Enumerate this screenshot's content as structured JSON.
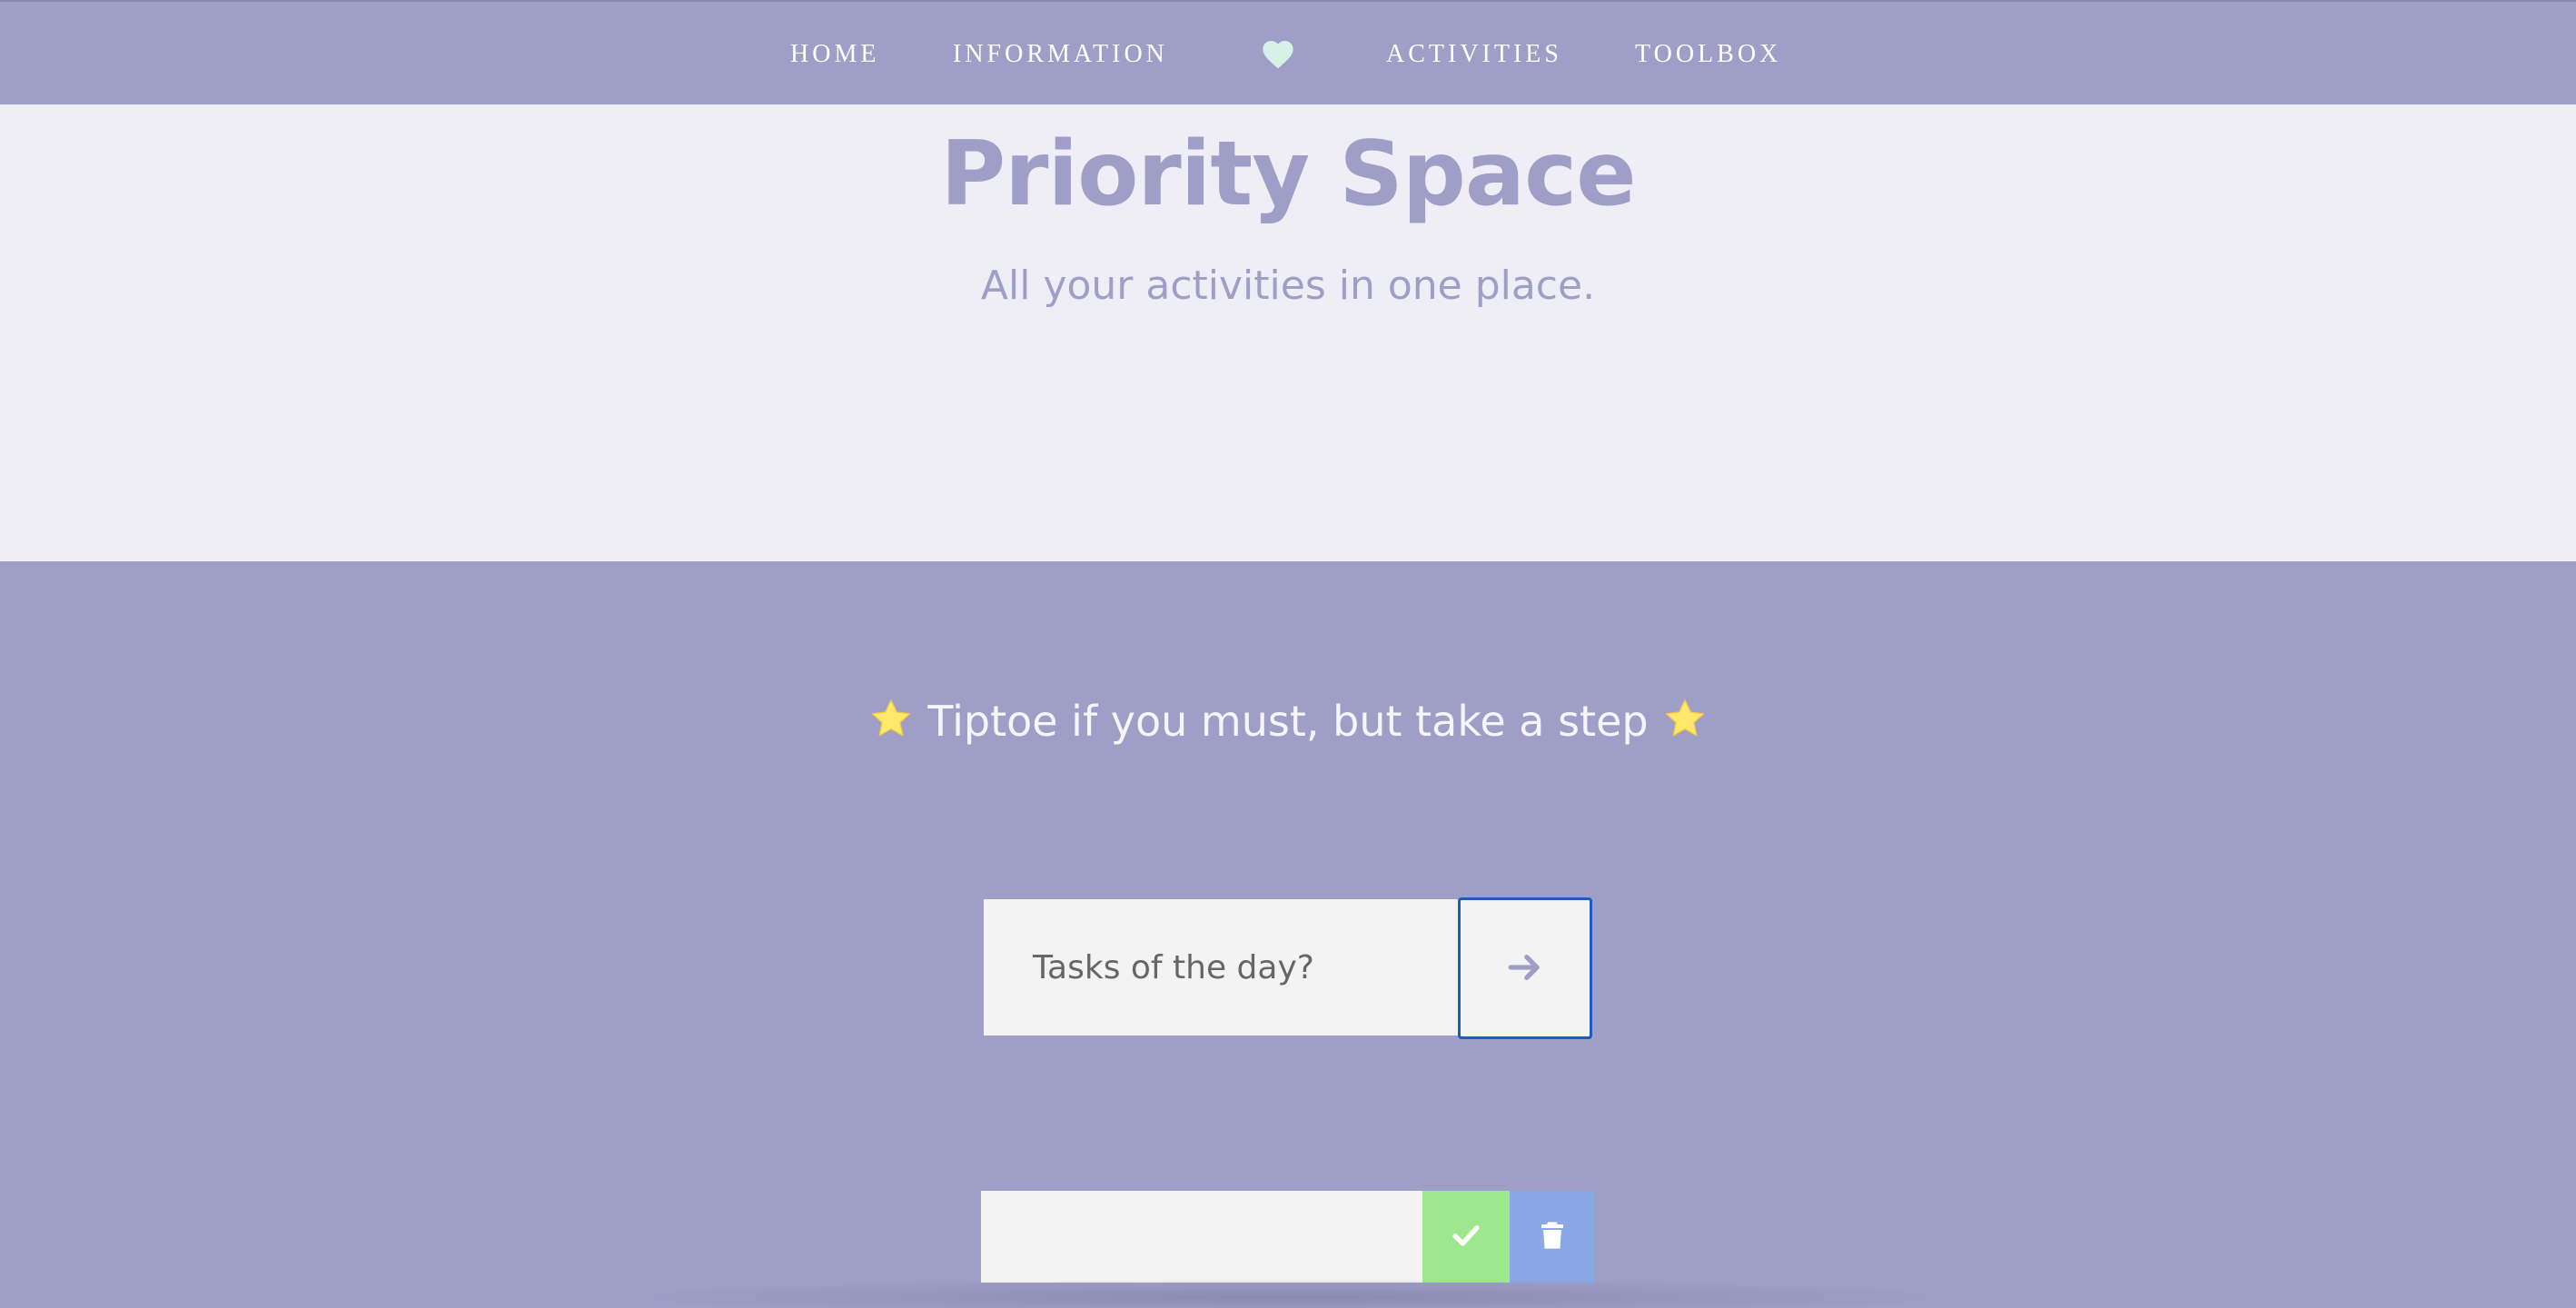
{
  "nav": {
    "items": [
      {
        "label": "HOME"
      },
      {
        "label": "INFORMATION"
      },
      {
        "label": "ACTIVITIES"
      },
      {
        "label": "TOOLBOX"
      }
    ],
    "heart_icon": "heart-icon",
    "heart_color": "#d5f1e8"
  },
  "hero": {
    "title": "Priority Space",
    "subtitle": "All your activities in one place."
  },
  "task_section": {
    "quote": "Tiptoe if you must, but take a step",
    "star_icon": "star-icon",
    "star_color": "#ffe86b",
    "input": {
      "value": "",
      "placeholder": "Tasks of the day?"
    },
    "submit_icon": "arrow-right-icon",
    "todo": {
      "text": "",
      "complete_icon": "check-icon",
      "delete_icon": "trash-icon"
    }
  },
  "colors": {
    "primary": "#9e9ec7",
    "hero_bg": "#efeef6",
    "input_bg": "#f3f3f3",
    "complete_btn": "#9de88c",
    "delete_btn": "#8aa8e4",
    "focus_ring": "#1f5bbd"
  }
}
